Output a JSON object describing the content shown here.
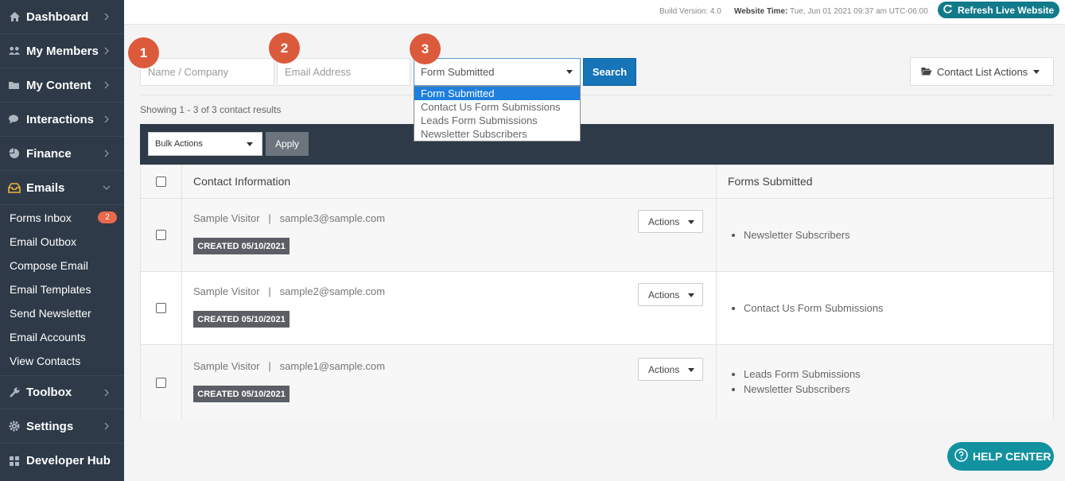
{
  "sidebar": {
    "items": [
      {
        "label": "Dashboard",
        "icon": "home-icon"
      },
      {
        "label": "My Members",
        "icon": "users-icon"
      },
      {
        "label": "My Content",
        "icon": "folder-icon"
      },
      {
        "label": "Interactions",
        "icon": "comments-icon"
      },
      {
        "label": "Finance",
        "icon": "pie-chart-icon"
      },
      {
        "label": "Emails",
        "icon": "inbox-icon"
      },
      {
        "label": "Toolbox",
        "icon": "wrench-icon"
      },
      {
        "label": "Settings",
        "icon": "gear-icon"
      },
      {
        "label": "Developer Hub",
        "icon": "grid-icon"
      }
    ],
    "email_subitems": [
      {
        "label": "Forms Inbox",
        "badge": "2"
      },
      {
        "label": "Email Outbox"
      },
      {
        "label": "Compose Email"
      },
      {
        "label": "Email Templates"
      },
      {
        "label": "Send Newsletter"
      },
      {
        "label": "Email Accounts"
      },
      {
        "label": "View Contacts"
      }
    ]
  },
  "topbar": {
    "build_version": "Build Version: 4.0",
    "website_time_label": "Website Time:",
    "website_time_value": "Tue, Jun 01 2021 09:37 am UTC-06:00",
    "refresh_label": "Refresh Live Website"
  },
  "filters": {
    "steps": [
      "1",
      "2",
      "3"
    ],
    "name_placeholder": "Name / Company",
    "email_placeholder": "Email Address",
    "form_selected": "Form Submitted",
    "form_options": [
      "Form Submitted",
      "Contact Us Form Submissions",
      "Leads Form Submissions",
      "Newsletter Subscribers"
    ],
    "search_label": "Search",
    "contact_list_actions": "Contact List Actions"
  },
  "results": {
    "showing": "Showing 1 - 3 of 3 contact results",
    "bulk_actions": "Bulk Actions",
    "apply": "Apply",
    "headers": {
      "contact": "Contact Information",
      "forms": "Forms Submitted"
    },
    "rows": [
      {
        "name": "Sample Visitor",
        "sep": "|",
        "email": "sample3@sample.com",
        "created": "CREATED 05/10/2021",
        "actions": "Actions",
        "forms": [
          "Newsletter Subscribers"
        ]
      },
      {
        "name": "Sample Visitor",
        "sep": "|",
        "email": "sample2@sample.com",
        "created": "CREATED 05/10/2021",
        "actions": "Actions",
        "forms": [
          "Contact Us Form Submissions"
        ]
      },
      {
        "name": "Sample Visitor",
        "sep": "|",
        "email": "sample1@sample.com",
        "created": "CREATED 05/10/2021",
        "actions": "Actions",
        "forms": [
          "Leads Form Submissions",
          "Newsletter Subscribers"
        ]
      }
    ]
  },
  "help_center": "HELP CENTER",
  "colors": {
    "sidebar": "#2e3a48",
    "accent": "#1774b8",
    "step": "#dc5a3c",
    "teal": "#12929f"
  }
}
